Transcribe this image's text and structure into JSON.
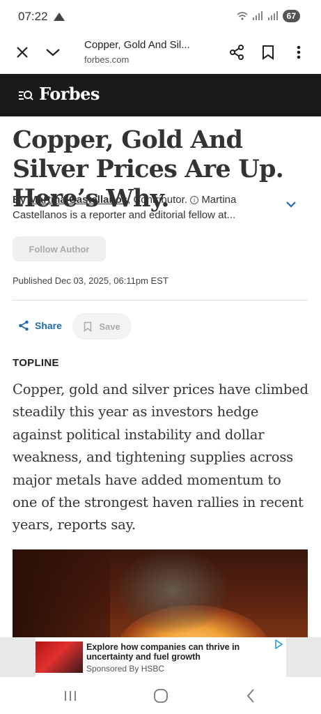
{
  "status_bar": {
    "time": "07:22",
    "battery": "67"
  },
  "browser": {
    "page_title": "Copper, Gold And Sil...",
    "domain": "forbes.com"
  },
  "site": {
    "logo": "Forbes"
  },
  "article": {
    "headline": "Copper, Gold And Silver Prices Are Up. Here’s Why.",
    "byline_prefix": "By",
    "author": "Martina Castellanos",
    "author_role": ", Contributor.",
    "author_bio": "Martina Castellanos is a reporter and editorial fellow at...",
    "follow_label": "Follow Author",
    "published": "Published Dec 03, 2025, 06:11pm EST",
    "share_label": "Share",
    "save_label": "Save",
    "section_label": "TOPLINE",
    "topline": "Copper, gold and silver prices have climbed steadily this year as investors hedge against political instability and dollar weakness, and tightening supplies across major metals have added momentum to one of the strongest haven rallies in recent years, reports say."
  },
  "ad": {
    "title": "Explore how companies can thrive in uncertainty and fuel growth",
    "sponsor": "Sponsored By HSBC"
  },
  "colors": {
    "header_bg": "#1a1a1a",
    "link_blue": "#1f6bb0"
  },
  "icons": [
    "close-icon",
    "chevron-down-icon",
    "share-icon",
    "bookmark-icon",
    "more-vert-icon",
    "menu-search-icon",
    "info-icon",
    "adchoices-icon",
    "recents-icon",
    "home-icon",
    "back-icon"
  ]
}
